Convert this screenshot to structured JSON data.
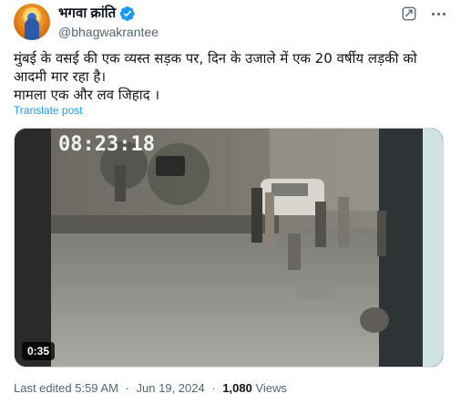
{
  "author": {
    "display_name": "भगवा क्रांति",
    "handle": "@bhagwakrantee",
    "verified": true
  },
  "post": {
    "text_line_1": "मुंबई के वसई की एक व्यस्त सड़क पर, दिन के उजाले में एक 20 वर्षीय लड़की को आदमी मार रहा है।",
    "text_line_2": "मामला एक और लव जिहाद ।",
    "translate_label": "Translate post"
  },
  "media": {
    "type": "video",
    "timestamp_overlay": "08:23:18",
    "duration": "0:35"
  },
  "meta": {
    "edited_label": "Last edited",
    "time": "5:59 AM",
    "date": "Jun 19, 2024",
    "views_count": "1,080",
    "views_label": "Views"
  },
  "colors": {
    "accent": "#1d9bf0",
    "secondary_text": "#536471",
    "primary_text": "#0f1419"
  },
  "icons": [
    "verified-badge-icon",
    "grok-icon",
    "more-icon"
  ]
}
